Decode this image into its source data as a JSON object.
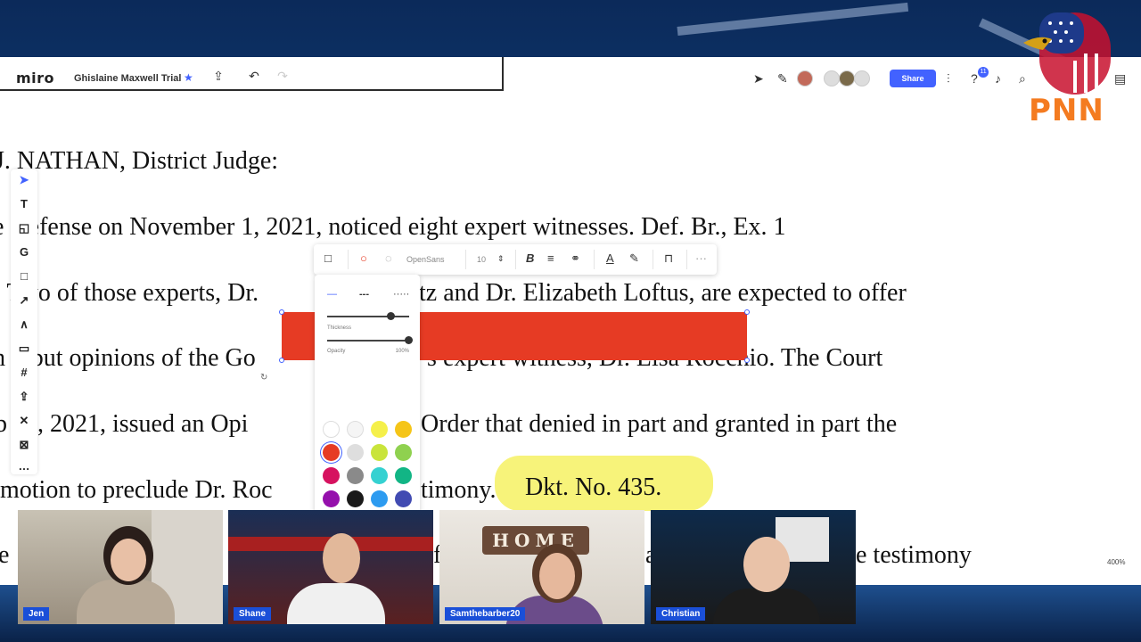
{
  "app": {
    "logo": "miro",
    "board_title": "Ghislaine Maxwell Trial",
    "share_label": "Share",
    "notification_count": "11",
    "zoom": "400%"
  },
  "document": {
    "lines": [
      "J. NATHAN, District Judge:",
      "e Defense on November 1, 2021, noticed eight expert witnesses.  Def. Br., Ex. 1",
      ". Two of those experts, Dr.",
      "tz and Dr. Elizabeth Loftus, are expected to offer",
      "h rebut opinions of the Go",
      "'s expert witness, Dr. Lisa Rocchio.  The Court",
      "b 11, 2021, issued an Opi",
      "Order that denied in part and granted in part the",
      "motion to preclude Dr. Roc",
      "timony.",
      "e",
      "f",
      "a",
      "e testimony"
    ],
    "highlighted": "Dkt. No. 435."
  },
  "context_toolbar": {
    "font": "OpenSans",
    "font_size": "10"
  },
  "line_panel": {
    "thickness_label": "Thickness",
    "opacity_label": "Opacity",
    "opacity_value": "100%",
    "thickness_level": 0.77,
    "opacity_level": 1.0
  },
  "swatches": [
    [
      "#ffffff",
      "#f5f5f5",
      "#f5f04a",
      "#f5c518"
    ],
    [
      "#e63b24",
      "#dedede",
      "#c9e43b",
      "#8fd14f"
    ],
    [
      "#d6125f",
      "#8a8a8a",
      "#35d1d1",
      "#12b585"
    ],
    [
      "#9510ac",
      "#1a1a1a",
      "#2d9bf0",
      "#414bb2"
    ],
    [
      "#652cb3",
      "#dcdcdc",
      "#8fc2ed",
      "#a6c3c0"
    ],
    [
      "#e0d4d4",
      "#d9735a",
      "#5de0a9",
      "#f0ad2e"
    ]
  ],
  "participants": [
    {
      "name": "Jen"
    },
    {
      "name": "Shane"
    },
    {
      "name": "Samthebarber20"
    },
    {
      "name": "Christian"
    }
  ],
  "home_sign": "HOME",
  "logo_text": "PNN",
  "colors": {
    "accent": "#4262ff",
    "shape_fill": "#e63b24",
    "highlight": "#f6f26b",
    "pnn_orange": "#f47b20",
    "nametag": "#1a4fd8"
  }
}
